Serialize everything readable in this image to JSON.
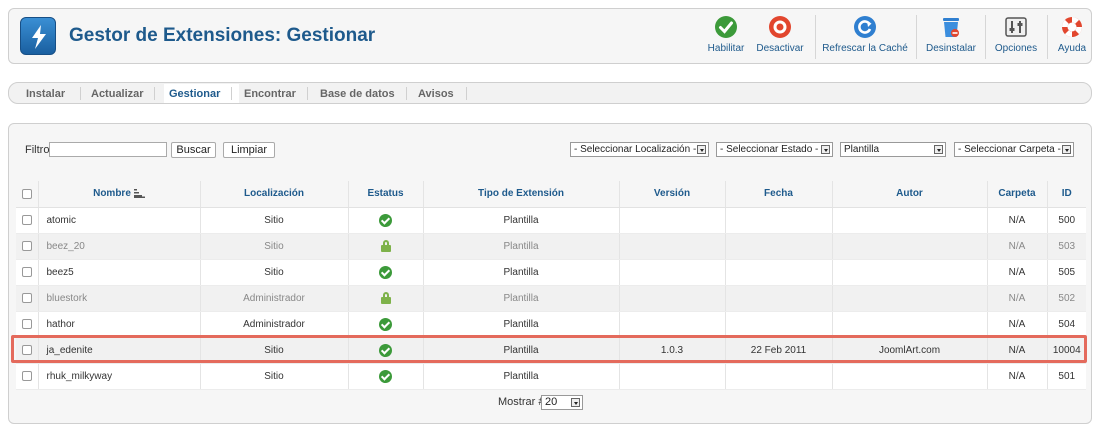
{
  "header": {
    "title": "Gestor de Extensiones: Gestionar",
    "toolbar": [
      {
        "key": "enable",
        "label": "Habilitar",
        "icon": "check-circle-icon"
      },
      {
        "key": "disable",
        "label": "Desactivar",
        "icon": "stop-circle-icon"
      },
      {
        "key": "refresh",
        "label": "Refrescar la Caché",
        "icon": "refresh-icon"
      },
      {
        "key": "uninstall",
        "label": "Desinstalar",
        "icon": "trash-icon"
      },
      {
        "key": "options",
        "label": "Opciones",
        "icon": "options-icon"
      },
      {
        "key": "help",
        "label": "Ayuda",
        "icon": "lifebuoy-icon"
      }
    ]
  },
  "submenu": {
    "items": [
      "Instalar",
      "Actualizar",
      "Gestionar",
      "Encontrar",
      "Base de datos",
      "Avisos"
    ],
    "active": "Gestionar"
  },
  "filter": {
    "label": "Filtro:",
    "value": "",
    "search_label": "Buscar",
    "clear_label": "Limpiar",
    "location_select": "- Seleccionar Localización -",
    "state_select": "- Seleccionar Estado -",
    "type_select": "Plantilla",
    "folder_select": "- Seleccionar Carpeta -"
  },
  "table": {
    "columns": [
      "Nombre",
      "Localización",
      "Estatus",
      "Tipo de Extensión",
      "Versión",
      "Fecha",
      "Autor",
      "Carpeta",
      "ID"
    ],
    "rows": [
      {
        "name": "atomic",
        "location": "Sitio",
        "status": "enabled",
        "type": "Plantilla",
        "version": "",
        "date": "",
        "author": "",
        "folder": "N/A",
        "id": "500"
      },
      {
        "name": "beez_20",
        "location": "Sitio",
        "status": "locked",
        "type": "Plantilla",
        "version": "",
        "date": "",
        "author": "",
        "folder": "N/A",
        "id": "503"
      },
      {
        "name": "beez5",
        "location": "Sitio",
        "status": "enabled",
        "type": "Plantilla",
        "version": "",
        "date": "",
        "author": "",
        "folder": "N/A",
        "id": "505"
      },
      {
        "name": "bluestork",
        "location": "Administrador",
        "status": "locked",
        "type": "Plantilla",
        "version": "",
        "date": "",
        "author": "",
        "folder": "N/A",
        "id": "502"
      },
      {
        "name": "hathor",
        "location": "Administrador",
        "status": "enabled",
        "type": "Plantilla",
        "version": "",
        "date": "",
        "author": "",
        "folder": "N/A",
        "id": "504"
      },
      {
        "name": "ja_edenite",
        "location": "Sitio",
        "status": "enabled",
        "type": "Plantilla",
        "version": "1.0.3",
        "date": "22 Feb 2011",
        "author": "JoomlArt.com",
        "folder": "N/A",
        "id": "10004"
      },
      {
        "name": "rhuk_milkyway",
        "location": "Sitio",
        "status": "enabled",
        "type": "Plantilla",
        "version": "",
        "date": "",
        "author": "",
        "folder": "N/A",
        "id": "501"
      }
    ]
  },
  "pagination": {
    "show_label": "Mostrar #",
    "value": "20"
  },
  "colors": {
    "title": "#1e5a8c",
    "enabled": "#3c9a3a",
    "locked": "#7eb24a",
    "highlight": "#e46a5c"
  }
}
